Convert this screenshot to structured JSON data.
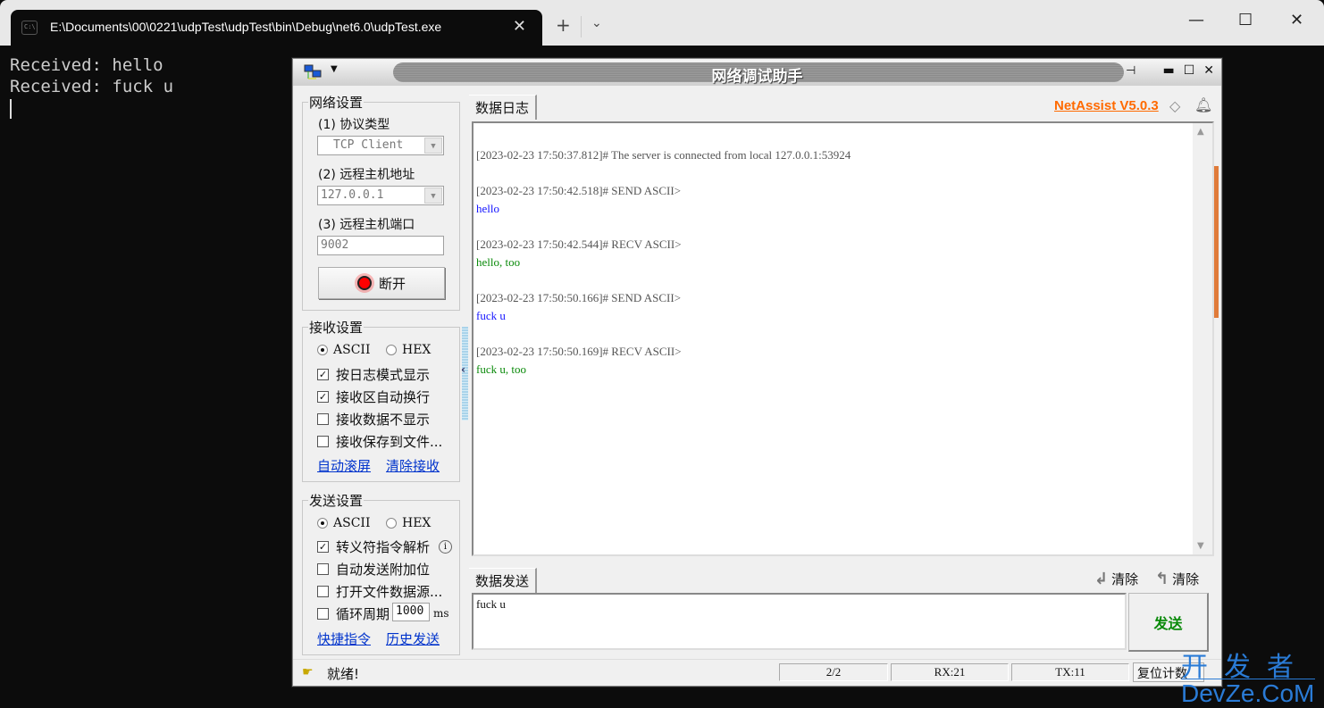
{
  "terminal": {
    "tab_title": "E:\\Documents\\00\\0221\\udpTest\\udpTest\\bin\\Debug\\net6.0\\udpTest.exe",
    "tab_icon": "C:\\",
    "close": "✕",
    "new_tab": "+",
    "dropdown": "⌄",
    "minimize": "—",
    "maximize": "☐",
    "window_close": "✕",
    "lines": [
      "Received: hello",
      "Received: fuck u"
    ]
  },
  "netassist": {
    "title": "网络调试助手",
    "brand": "NetAssist V5.0.3",
    "title_controls": {
      "pin": "⊣",
      "min": "▬",
      "max": "☐",
      "close": "✕"
    },
    "network": {
      "legend": "网络设置",
      "protocol_label": "(1) 协议类型",
      "protocol_value": "TCP Client",
      "host_label": "(2) 远程主机地址",
      "host_value": "127.0.0.1",
      "port_label": "(3) 远程主机端口",
      "port_value": "9002",
      "connect_button": "断开"
    },
    "receive": {
      "legend": "接收设置",
      "ascii": "ASCII",
      "hex": "HEX",
      "options": [
        {
          "label": "按日志模式显示",
          "checked": true
        },
        {
          "label": "接收区自动换行",
          "checked": true
        },
        {
          "label": "接收数据不显示",
          "checked": false
        },
        {
          "label": "接收保存到文件...",
          "checked": false
        }
      ],
      "link_autoscroll": "自动滚屏",
      "link_clear": "清除接收"
    },
    "send": {
      "legend": "发送设置",
      "ascii": "ASCII",
      "hex": "HEX",
      "options": [
        {
          "label": "转义符指令解析",
          "checked": true
        },
        {
          "label": "自动发送附加位",
          "checked": false
        },
        {
          "label": "打开文件数据源...",
          "checked": false
        },
        {
          "label": "循环周期",
          "checked": false
        }
      ],
      "cycle_value": "1000",
      "cycle_unit": "ms",
      "link_shortcut": "快捷指令",
      "link_history": "历史发送"
    },
    "log_tab": "数据日志",
    "send_tab": "数据发送",
    "log": [
      {
        "ts": "[2023-02-23 17:50:37.812]# The server is connected from local 127.0.0.1:53924",
        "body": "",
        "kind": ""
      },
      {
        "ts": "[2023-02-23 17:50:42.518]# SEND ASCII>",
        "body": "hello",
        "kind": "send"
      },
      {
        "ts": "[2023-02-23 17:50:42.544]# RECV ASCII>",
        "body": "hello, too",
        "kind": "recv"
      },
      {
        "ts": "[2023-02-23 17:50:50.166]# SEND ASCII>",
        "body": "fuck u",
        "kind": "send"
      },
      {
        "ts": "[2023-02-23 17:50:50.169]# RECV ASCII>",
        "body": "fuck u, too",
        "kind": "recv"
      }
    ],
    "send_text": "fuck u",
    "send_button": "发送",
    "clear_recv": "清除",
    "clear_send": "清除",
    "status": {
      "ready": "就绪!",
      "count": "2/2",
      "rx": "RX:21",
      "tx": "TX:11",
      "reset": "复位计数"
    }
  },
  "watermark": {
    "cn": "开发者",
    "en": "DevZe.CoM"
  }
}
